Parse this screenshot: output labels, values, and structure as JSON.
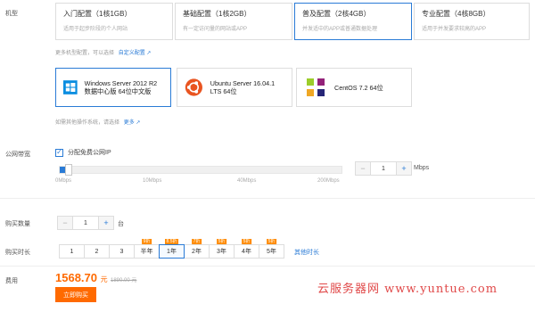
{
  "labels": {
    "model": "机型",
    "bandwidth": "公网带宽",
    "quantity": "购买数量",
    "duration": "购买时长",
    "fee": "费用"
  },
  "configs": [
    {
      "title": "入门配置（1核1GB）",
      "desc": "适用于起步阶段的个人网站"
    },
    {
      "title": "基础配置（1核2GB）",
      "desc": "有一定访问量的网站或APP"
    },
    {
      "title": "普及配置（2核4GB）",
      "desc": "并发适中的APP或普通数据处理"
    },
    {
      "title": "专业配置（4核8GB）",
      "desc": "适用于并发要求较高的APP"
    }
  ],
  "more_configs": {
    "text": "更多机型配置，可以选择",
    "link": "自定义配置"
  },
  "os": [
    {
      "name": "Windows Server 2012 R2 数据中心版 64位中文版",
      "icon": "windows-icon"
    },
    {
      "name": "Ubuntu Server 16.04.1 LTS 64位",
      "icon": "ubuntu-icon"
    },
    {
      "name": "CentOS 7.2 64位",
      "icon": "centos-icon"
    }
  ],
  "more_os": {
    "text": "如需其他操作系统，请选择",
    "link": "更多"
  },
  "bandwidth": {
    "checkbox_label": "分配免费公网IP",
    "ticks": [
      "0Mbps",
      "10Mbps",
      "40Mbps",
      "200Mbps"
    ],
    "value": "1",
    "unit": "Mbps"
  },
  "quantity": {
    "value": "1",
    "unit": "台"
  },
  "durations": [
    {
      "label": "1",
      "tag": ""
    },
    {
      "label": "2",
      "tag": ""
    },
    {
      "label": "3",
      "tag": ""
    },
    {
      "label": "半年",
      "tag": "9折"
    },
    {
      "label": "1年",
      "tag": "8.5折"
    },
    {
      "label": "2年",
      "tag": "7折"
    },
    {
      "label": "3年",
      "tag": "5折"
    },
    {
      "label": "4年",
      "tag": "5折"
    },
    {
      "label": "5年",
      "tag": "5折"
    }
  ],
  "other_duration": "其他时长",
  "price": {
    "value": "1568.70",
    "unit": "元",
    "original": "1890.00 元"
  },
  "buy_button": "立即购买",
  "watermark": "云服务器网 www.yuntue.com"
}
